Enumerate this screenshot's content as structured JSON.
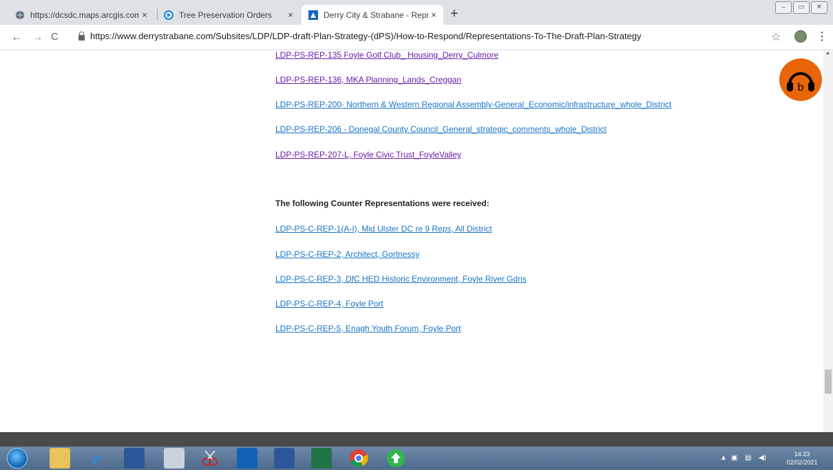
{
  "browser": {
    "tabs": [
      {
        "title": "https://dcsdc.maps.arcgis.com/a",
        "close": "×"
      },
      {
        "title": "Tree Preservation Orders",
        "close": "×"
      },
      {
        "title": "Derry City & Strabane - Represen",
        "close": "×"
      }
    ],
    "new_tab": "+",
    "url": "https://www.derrystrabane.com/Subsites/LDP/LDP-draft-Plan-Strategy-(dPS)/How-to-Respond/Representations-To-The-Draft-Plan-Strategy",
    "nav": {
      "back": "←",
      "forward": "→",
      "reload": "C"
    },
    "window": {
      "minimize": "–",
      "restore": "▭",
      "close": "✕"
    }
  },
  "page": {
    "representations": [
      "LDP-PS-REP-135 Foyle Golf Club_ Housing_Derry_Culmore",
      "LDP-PS-REP-136, MKA Planning_Lands_Creggan",
      "LDP-PS-REP-200- Northern & Western Regional Assembly-General_Economic/infrastructure_whole_District",
      "LDP-PS-REP-206 - Donegal County Council_General_strategic_comments_whole_District",
      "LDP-PS-REP-207-L, Foyle Civic Trust_FoyleValley"
    ],
    "counter_heading": "The following Counter Representations were received:",
    "counter_representations": [
      "LDP-PS-C-REP-1(A-I), Mid Ulster DC re 9 Reps, All District",
      "LDP-PS-C-REP-2, Architect, Gortnessy",
      "LDP-PS-C-REP-3, DfC HED Historic Environment, Foyle River Gdns",
      "LDP-PS-C-REP-4, Foyle Port",
      "LDP-PS-C-REP-5, Enagh Youth Forum, Foyle Port"
    ]
  },
  "taskbar": {
    "time": "14:23",
    "date": "02/02/2021"
  },
  "colors": {
    "link": "#1a73c4",
    "visited": "#681da8",
    "audio_button": "#e8650a"
  }
}
